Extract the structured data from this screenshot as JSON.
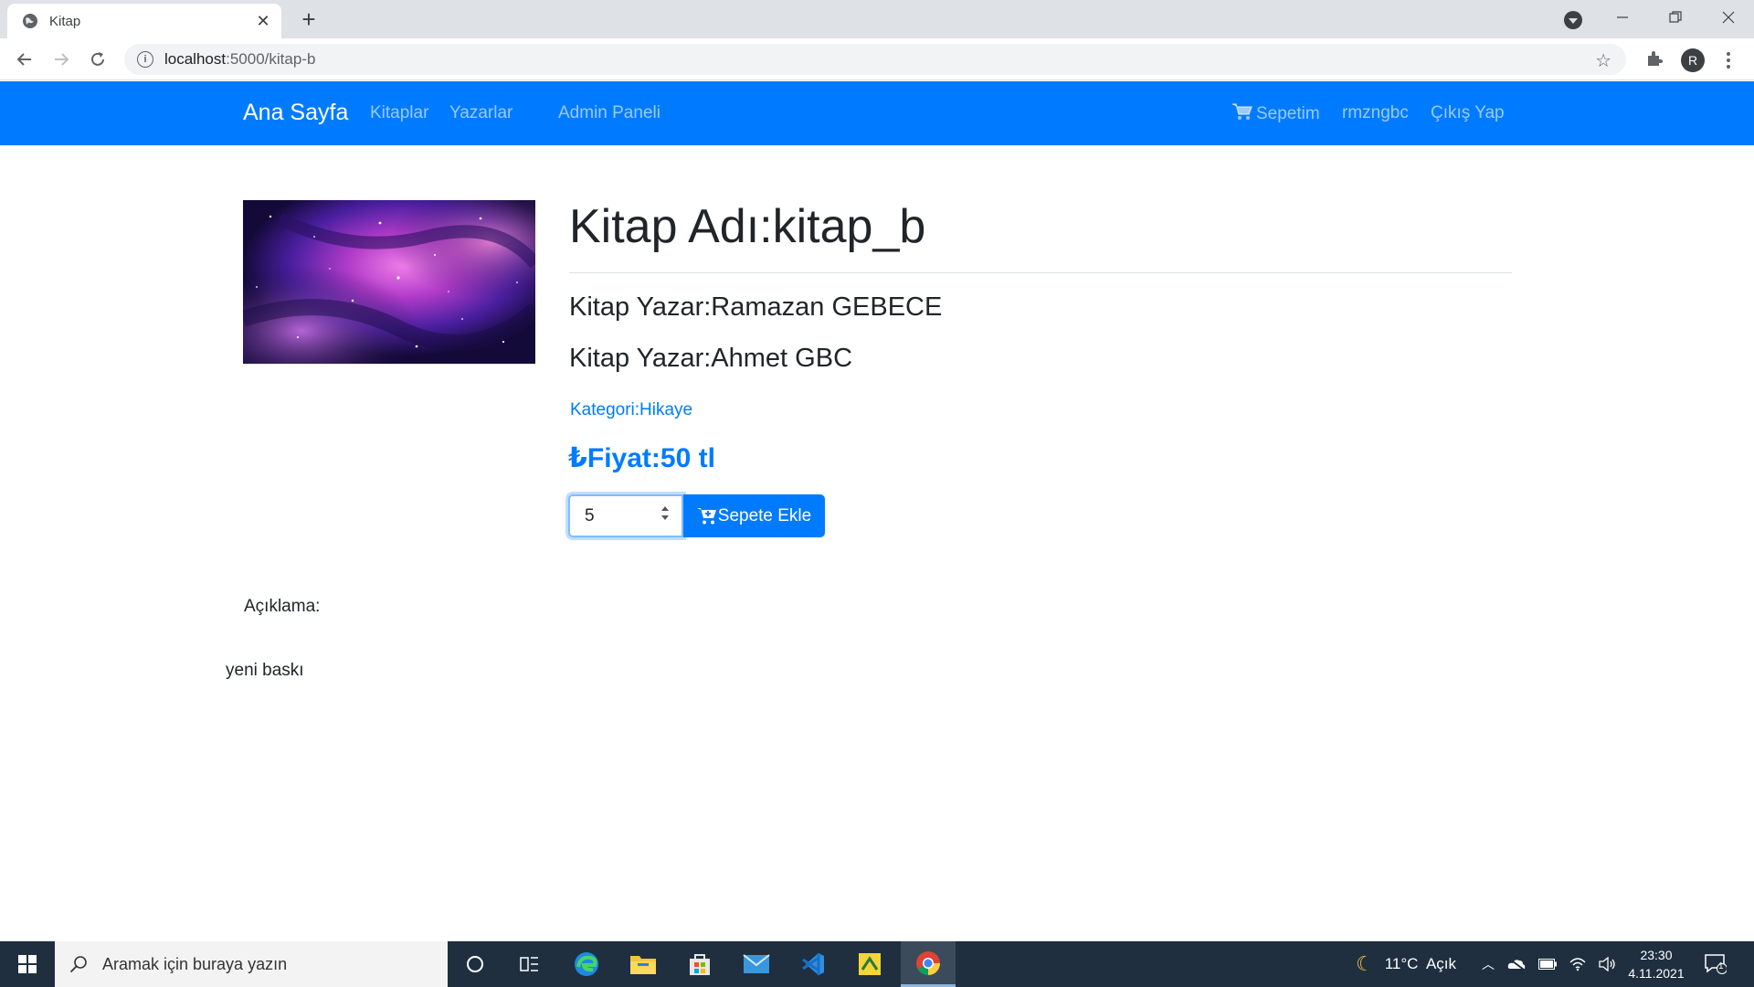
{
  "browser": {
    "tab_title": "Kitap",
    "url_host": "localhost",
    "url_rest": ":5000/kitap-b"
  },
  "navbar": {
    "brand": "Ana Sayfa",
    "links": [
      "Kitaplar",
      "Yazarlar",
      "Admin Paneli"
    ],
    "cart": "Sepetim",
    "user": "rmzngbc",
    "logout": "Çıkış Yap"
  },
  "book": {
    "title": "Kitap Adı:kitap_b",
    "authors": [
      "Kitap Yazar:Ramazan GEBECE",
      "Kitap Yazar:Ahmet GBC"
    ],
    "category": "Kategori:Hikaye",
    "price": "Fiyat:50 tl",
    "currency_symbol": "₺",
    "quantity": "5",
    "add_to_cart": "Sepete Ekle",
    "description_label": "Açıklama:",
    "description": "yeni baskı"
  },
  "taskbar": {
    "search_placeholder": "Aramak için buraya yazın",
    "weather": "11°C  Açık",
    "time": "23:30",
    "date": "4.11.2021",
    "notifications": "1"
  },
  "colors": {
    "primary": "#007bff",
    "taskbar": "#1f2f3f",
    "tabstrip": "#dee1e6"
  }
}
